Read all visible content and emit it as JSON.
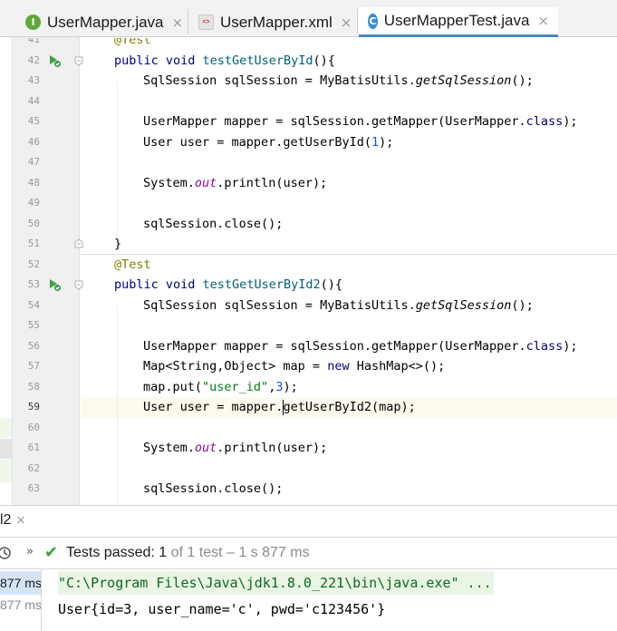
{
  "tabs": [
    {
      "label": "UserMapper.java",
      "icon": "interface-icon",
      "icon_glyph": "I",
      "icon_color": "#5fa83a",
      "active": false
    },
    {
      "label": "UserMapper.xml",
      "icon": "xml-file-icon",
      "icon_glyph": "<>",
      "icon_color": "#c0392b",
      "active": false
    },
    {
      "label": "UserMapperTest.java",
      "icon": "class-icon",
      "icon_glyph": "C",
      "icon_color": "#3d8fd4",
      "active": true
    }
  ],
  "tab_close_glyph": "×",
  "editor": {
    "line_numbers": [
      "41",
      "42",
      "43",
      "44",
      "45",
      "46",
      "47",
      "48",
      "49",
      "50",
      "51",
      "52",
      "53",
      "54",
      "55",
      "56",
      "57",
      "58",
      "59",
      "60",
      "61",
      "62",
      "63"
    ],
    "current_line": "59"
  },
  "run_panel": {
    "tab_label": "l2",
    "tab_close_glyph": "×",
    "status": {
      "prefix": "Tests passed: ",
      "passed": "1",
      "suffix": " of 1 test – 1 s 877 ms"
    },
    "tree": [
      {
        "label": "877 ms",
        "selected": true
      },
      {
        "label": "877 ms",
        "selected": false
      }
    ],
    "console": [
      {
        "text": "\"C:\\Program Files\\Java\\jdk1.8.0_221\\bin\\java.exe\" ...",
        "kind": "cmd"
      },
      {
        "text": "User{id=3, user_name='c', pwd='c123456'}",
        "kind": "out"
      }
    ]
  },
  "colors": {
    "keyword": "#000080",
    "annotation": "#808000",
    "string": "#067d17",
    "number": "#1750eb",
    "static_field": "#871094",
    "passed_check": "#3f9f3f",
    "active_tab_underline": "#4a88c7"
  }
}
